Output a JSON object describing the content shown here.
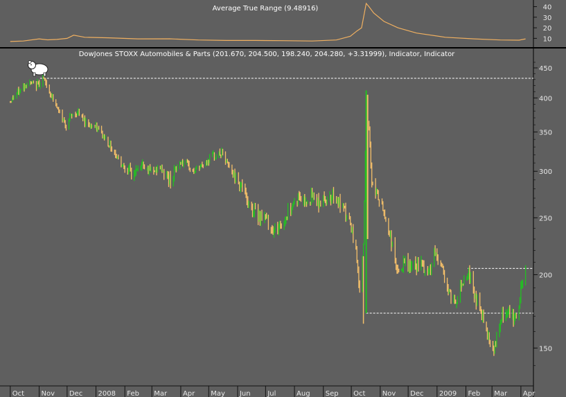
{
  "chart_data": [
    {
      "type": "line",
      "title": "Average True Range (9.48916)",
      "ylim": [
        5,
        43
      ],
      "y_ticks": [
        "10",
        "20",
        "30",
        "40"
      ],
      "series": [
        {
          "color": "#f0b060",
          "x": [
            "2007-10-01",
            "2007-10-15",
            "2007-11-01",
            "2007-11-10",
            "2007-11-20",
            "2007-12-01",
            "2007-12-08",
            "2007-12-20",
            "2008-01-15",
            "2008-02-15",
            "2008-03-20",
            "2008-04-20",
            "2008-05-20",
            "2008-06-20",
            "2008-07-20",
            "2008-08-20",
            "2008-09-15",
            "2008-09-30",
            "2008-10-07",
            "2008-10-12",
            "2008-10-17",
            "2008-10-20",
            "2008-10-25",
            "2008-11-05",
            "2008-11-20",
            "2008-12-10",
            "2009-01-10",
            "2009-02-10",
            "2009-03-10",
            "2009-03-30",
            "2009-04-06"
          ],
          "values": [
            7,
            7.5,
            9.5,
            8.6,
            9,
            10,
            13,
            11,
            10.5,
            9.5,
            9.6,
            8.5,
            8,
            8,
            7.8,
            7.5,
            8.5,
            12,
            17,
            20,
            43,
            40,
            34,
            26,
            20,
            15,
            11,
            9.5,
            8.5,
            8.3,
            9.5
          ]
        }
      ]
    },
    {
      "type": "candlestick",
      "title": "DowJones STOXX Automobiles & Parts (201.670, 204.500, 198.240, 204.280, +3.31999), Indicator, Indicator",
      "y_scale": "log",
      "ylim": [
        130,
        470
      ],
      "y_ticks": [
        "150",
        "200",
        "250",
        "300",
        "350",
        "400",
        "450"
      ],
      "x_ticks": [
        "Oct",
        "Nov",
        "Dec",
        "2008",
        "Feb",
        "Mar",
        "Apr",
        "May",
        "Jun",
        "Jul",
        "Aug",
        "Sep",
        "Oct",
        "Nov",
        "Dec",
        "2009",
        "Feb",
        "Mar",
        "Apr"
      ],
      "up_color": "#22c022",
      "down_color": "#f5c06a",
      "close_path": {
        "x": [
          "2007-10-01",
          "2007-10-10",
          "2007-10-20",
          "2007-10-28",
          "2007-11-05",
          "2007-11-14",
          "2007-11-22",
          "2007-11-30",
          "2007-12-05",
          "2007-12-12",
          "2007-12-20",
          "2008-01-05",
          "2008-01-20",
          "2008-01-28",
          "2008-02-10",
          "2008-02-20",
          "2008-03-01",
          "2008-03-10",
          "2008-03-20",
          "2008-04-01",
          "2008-04-15",
          "2008-04-25",
          "2008-05-05",
          "2008-05-15",
          "2008-05-25",
          "2008-06-05",
          "2008-06-12",
          "2008-06-20",
          "2008-07-01",
          "2008-07-10",
          "2008-07-20",
          "2008-07-28",
          "2008-08-05",
          "2008-08-12",
          "2008-08-20",
          "2008-08-28",
          "2008-09-05",
          "2008-09-12",
          "2008-09-20",
          "2008-09-28",
          "2008-10-02",
          "2008-10-07",
          "2008-10-10",
          "2008-10-14",
          "2008-10-16",
          "2008-10-18",
          "2008-10-20",
          "2008-10-23",
          "2008-10-28",
          "2008-11-05",
          "2008-11-12",
          "2008-11-20",
          "2008-11-28",
          "2008-12-05",
          "2008-12-15",
          "2008-12-22",
          "2008-12-30",
          "2009-01-07",
          "2009-01-14",
          "2009-01-21",
          "2009-01-28",
          "2009-02-04",
          "2009-02-10",
          "2009-02-18",
          "2009-02-25",
          "2009-03-02",
          "2009-03-06",
          "2009-03-12",
          "2009-03-18",
          "2009-03-24",
          "2009-03-30",
          "2009-04-01",
          "2009-04-06"
        ],
        "close": [
          395,
          410,
          425,
          418,
          432,
          405,
          378,
          360,
          372,
          378,
          365,
          352,
          325,
          310,
          295,
          310,
          298,
          305,
          290,
          312,
          300,
          308,
          318,
          322,
          300,
          285,
          265,
          255,
          250,
          238,
          245,
          262,
          270,
          268,
          272,
          265,
          270,
          275,
          260,
          250,
          235,
          215,
          185,
          230,
          320,
          405,
          350,
          290,
          275,
          255,
          232,
          200,
          210,
          205,
          208,
          200,
          218,
          205,
          185,
          180,
          195,
          202,
          185,
          172,
          158,
          150,
          155,
          170,
          172,
          168,
          175,
          190,
          204
        ]
      },
      "annotations": {
        "peak_level": 432,
        "oct_low_level": 172,
        "feb_high_level": 205,
        "bear_icon": "bear-icon"
      }
    }
  ]
}
